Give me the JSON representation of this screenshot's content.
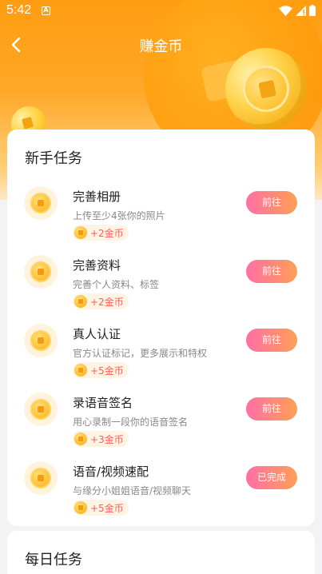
{
  "status_bar": {
    "time": "5:42",
    "notification_icon": "A"
  },
  "header": {
    "title": "赚金币",
    "back_icon": "chevron-left-icon"
  },
  "newbie_section": {
    "title": "新手任务",
    "tasks": [
      {
        "name": "完善相册",
        "desc": "上传至少4张你的照片",
        "reward": "+2金币",
        "action": "前往"
      },
      {
        "name": "完善资料",
        "desc": "完善个人资料、标签",
        "reward": "+2金币",
        "action": "前往"
      },
      {
        "name": "真人认证",
        "desc": "官方认证标记，更多展示和特权",
        "reward": "+5金币",
        "action": "前往"
      },
      {
        "name": "录语音签名",
        "desc": "用心录制一段你的语音签名",
        "reward": "+3金币",
        "action": "前往"
      },
      {
        "name": "语音/视频速配",
        "desc": "与缘分小姐姐语音/视频聊天",
        "reward": "+5金币",
        "action": "已完成"
      }
    ]
  },
  "daily_section": {
    "title": "每日任务"
  },
  "colors": {
    "header_orange": "#ff9d10",
    "button_gradient_start": "#ff6fa5",
    "button_gradient_end": "#ff9f55",
    "reward_text": "#ff5d5d"
  }
}
